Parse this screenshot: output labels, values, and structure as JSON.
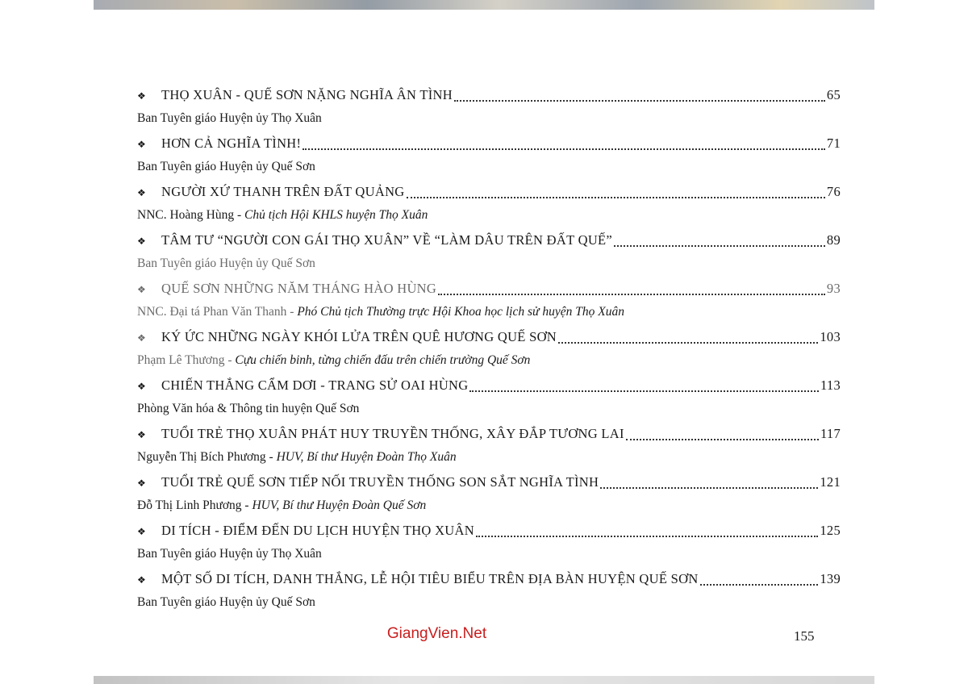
{
  "toc": {
    "bullet": "❖",
    "entries": [
      {
        "title": "THỌ XUÂN - QUẾ SƠN NẶNG NGHĨA ÂN TÌNH",
        "page": "65",
        "author": "Ban Tuyên giáo Huyện ủy Thọ Xuân",
        "role": ""
      },
      {
        "title": "HƠN CẢ NGHĨA TÌNH!",
        "page": "71",
        "author": "Ban Tuyên giáo Huyện ủy Quế Sơn",
        "role": ""
      },
      {
        "title": "NGƯỜI XỨ THANH TRÊN ĐẤT QUẢNG",
        "page": "76",
        "author": "NNC. Hoàng Hùng - ",
        "role": "Chủ tịch Hội KHLS huyện Thọ Xuân"
      },
      {
        "title": "TÂM TƯ “NGƯỜI CON GÁI THỌ XUÂN” VỀ “LÀM DÂU TRÊN ĐẤT QUẾ”",
        "page": "89",
        "author": "Ban Tuyên giáo Huyện ủy Quế Sơn",
        "role": ""
      },
      {
        "title": "QUẾ SƠN NHỮNG NĂM THÁNG HÀO HÙNG",
        "page": "93",
        "author": "NNC. Đại tá Phan Văn Thanh - ",
        "role": "Phó Chủ tịch Thường trực Hội Khoa học lịch sử huyện Thọ Xuân"
      },
      {
        "title": "KÝ ỨC NHỮNG NGÀY KHÓI LỬA TRÊN QUÊ HƯƠNG QUẾ SƠN",
        "page": "103",
        "author": "Phạm Lê Thương - ",
        "role": "Cựu chiến binh, từng chiến đấu trên chiến trường Quế Sơn"
      },
      {
        "title": "CHIẾN THẮNG CẨM DƠI - TRANG SỬ OAI HÙNG",
        "page": "113",
        "author": "Phòng Văn hóa & Thông tin huyện Quế Sơn",
        "role": ""
      },
      {
        "title": "TUỔI TRẺ THỌ XUÂN PHÁT HUY TRUYỀN THỐNG, XÂY ĐẮP TƯƠNG LAI",
        "page": "117",
        "author": "Nguyễn Thị Bích Phương - ",
        "role": "HUV, Bí thư Huyện Đoàn Thọ Xuân"
      },
      {
        "title": "TUỔI TRẺ QUẾ SƠN TIẾP NỐI TRUYỀN THỐNG SON SẮT NGHĨA TÌNH",
        "page": "121",
        "author": "Đỗ Thị Linh Phương - ",
        "role": "HUV, Bí thư Huyện Đoàn Quế Sơn"
      },
      {
        "title": "DI TÍCH - ĐIỂM ĐẾN DU LỊCH HUYỆN THỌ XUÂN",
        "page": "125",
        "author": "Ban Tuyên giáo Huyện ủy Thọ Xuân",
        "role": ""
      },
      {
        "title": "MỘT SỐ DI TÍCH, DANH THẮNG, LỄ HỘI TIÊU BIỂU  TRÊN ĐỊA BÀN HUYỆN QUẾ SƠN",
        "page": "139",
        "author": "Ban Tuyên giáo Huyện ủy Quế Sơn",
        "role": ""
      }
    ]
  },
  "footer": {
    "watermark": "GiangVien.Net",
    "page_number": "155"
  },
  "colors": {
    "watermark": "#c81e1e",
    "text": "#1a1a1a"
  }
}
